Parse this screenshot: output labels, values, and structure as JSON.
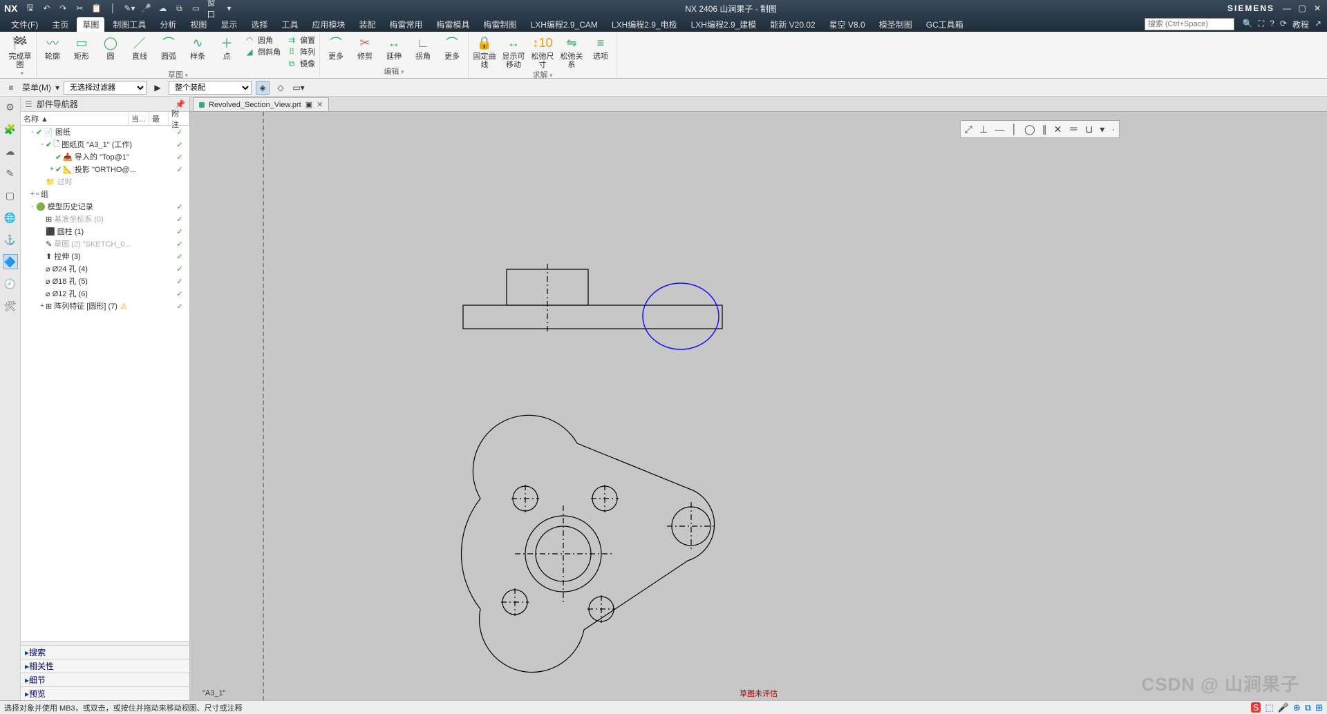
{
  "app": {
    "nx": "NX",
    "title": "NX 2406 山涧果子 - 制图",
    "brand": "SIEMENS"
  },
  "qat": [
    "save",
    "undo",
    "redo",
    "cut",
    "copy",
    "paste",
    "touch",
    "mic",
    "cloud",
    "copywin",
    "window",
    "dd"
  ],
  "window_menu_label": "窗口",
  "menus": [
    "文件(F)",
    "主页",
    "草图",
    "制图工具",
    "分析",
    "视图",
    "显示",
    "选择",
    "工具",
    "应用模块",
    "装配",
    "梅雷常用",
    "梅雷模具",
    "梅雷制图",
    "LXH编程2.9_CAM",
    "LXH编程2.9_电极",
    "LXH编程2.9_建模",
    "能新 V20.02",
    "星空 V8.0",
    "模圣制图",
    "GC工具箱"
  ],
  "active_menu_index": 2,
  "search_placeholder": "搜索 (Ctrl+Space)",
  "tutorial_label": "教程",
  "ribbon": {
    "g1": {
      "name": "",
      "items": [
        {
          "lbl": "完成草图"
        }
      ]
    },
    "g2": {
      "name": "草图",
      "items": [
        {
          "lbl": "轮廓"
        },
        {
          "lbl": "矩形"
        },
        {
          "lbl": "圆"
        },
        {
          "lbl": "直线"
        },
        {
          "lbl": "圆弧"
        },
        {
          "lbl": "样条"
        },
        {
          "lbl": "点"
        }
      ],
      "side": [
        {
          "lbl": "圆角"
        },
        {
          "lbl": "倒斜角"
        }
      ],
      "side2": [
        {
          "lbl": "偏置"
        },
        {
          "lbl": "阵列"
        },
        {
          "lbl": "镜像"
        }
      ]
    },
    "g3": {
      "name": "编辑",
      "items": [
        {
          "lbl": "更多"
        },
        {
          "lbl": "修剪"
        },
        {
          "lbl": "延伸"
        },
        {
          "lbl": "拐角"
        },
        {
          "lbl": "更多"
        }
      ]
    },
    "g4": {
      "name": "求解",
      "items": [
        {
          "lbl": "固定曲线"
        },
        {
          "lbl": "显示可移动"
        },
        {
          "lbl": "松弛尺寸"
        },
        {
          "lbl": "松弛关系"
        },
        {
          "lbl": "选项"
        }
      ]
    }
  },
  "filter": {
    "menu_btn": "菜单(M)",
    "combo1": "无选择过滤器",
    "combo2": "整个装配"
  },
  "navigator": {
    "title": "部件导航器",
    "cols": {
      "c1": "名称 ▲",
      "c2": "当...",
      "c3": "最",
      "c4": "附注"
    },
    "tree": [
      {
        "ind": 0,
        "tg": "-",
        "chk": true,
        "ic": "📄",
        "txt": "图纸",
        "st": "✓"
      },
      {
        "ind": 1,
        "tg": "-",
        "chk": true,
        "ic": "🗋",
        "txt": "图纸页 \"A3_1\" (工作)",
        "st": "✓"
      },
      {
        "ind": 2,
        "tg": "",
        "chk": true,
        "ic": "📥",
        "txt": "导入的 \"Top@1\"",
        "st": "✓"
      },
      {
        "ind": 2,
        "tg": "+",
        "chk": true,
        "ic": "📐",
        "txt": "投影 \"ORTHO@...",
        "st": "✓"
      },
      {
        "ind": 1,
        "tg": "",
        "chk": false,
        "ic": "📁",
        "txt": "过时",
        "gray": true,
        "st": ""
      },
      {
        "ind": 0,
        "tg": "+",
        "chk": false,
        "ic": "▫",
        "txt": "组",
        "st": ""
      },
      {
        "ind": 0,
        "tg": "-",
        "chk": false,
        "ic": "🟢",
        "txt": "模型历史记录",
        "st": "✓"
      },
      {
        "ind": 1,
        "tg": "",
        "chk": false,
        "ic": "⊞",
        "txt": "基准坐标系 (0)",
        "gray": true,
        "st": "✓"
      },
      {
        "ind": 1,
        "tg": "",
        "chk": false,
        "ic": "⬛",
        "txt": "圆柱 (1)",
        "st": "✓"
      },
      {
        "ind": 1,
        "tg": "",
        "chk": false,
        "ic": "✎",
        "txt": "草图 (2) \"SKETCH_0...",
        "gray": true,
        "st": "✓"
      },
      {
        "ind": 1,
        "tg": "",
        "chk": false,
        "ic": "⬆",
        "txt": "拉伸 (3)",
        "st": "✓"
      },
      {
        "ind": 1,
        "tg": "",
        "chk": false,
        "ic": "⌀",
        "txt": "Ø24 孔 (4)",
        "st": "✓"
      },
      {
        "ind": 1,
        "tg": "",
        "chk": false,
        "ic": "⌀",
        "txt": "Ø18 孔 (5)",
        "st": "✓"
      },
      {
        "ind": 1,
        "tg": "",
        "chk": false,
        "ic": "⌀",
        "txt": "Ø12 孔 (6)",
        "st": "✓"
      },
      {
        "ind": 1,
        "tg": "+",
        "chk": false,
        "ic": "⊞",
        "txt": "阵列特征 [圆形] (7)",
        "st": "✓",
        "warn": true
      }
    ],
    "sections": [
      "搜索",
      "相关性",
      "细节",
      "预览"
    ]
  },
  "tab": {
    "name": "Revolved_Section_View.prt",
    "dirty": true
  },
  "sheet_label": "\"A3_1\"",
  "eval_note": "草图未评估",
  "status": "选择对象并使用 MB3，或双击，或按住并拖动来移动视图、尺寸或注释",
  "watermark": "CSDN @ 山涧果子"
}
